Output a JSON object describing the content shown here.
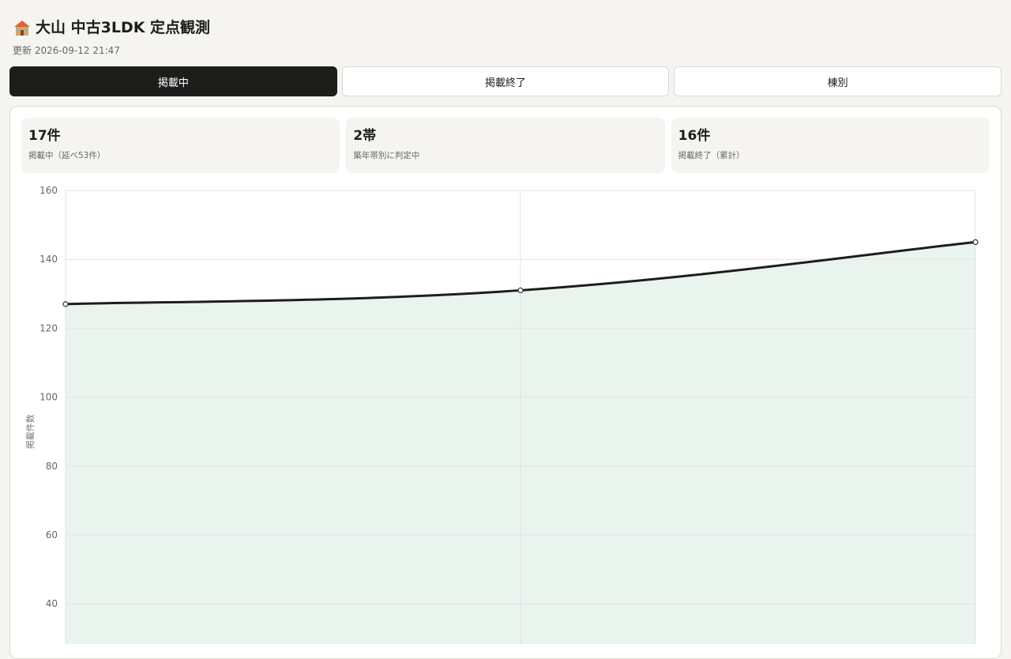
{
  "header": {
    "icon": "house-icon",
    "title": "大山 中古3LDK 定点観測",
    "updated": "更新 2026-09-12 21:47"
  },
  "tabs": [
    {
      "label": "掲載中",
      "active": true
    },
    {
      "label": "掲載終了",
      "active": false
    },
    {
      "label": "棟別",
      "active": false
    }
  ],
  "stats": [
    {
      "value": "17件",
      "label": "掲載中（延べ53件）"
    },
    {
      "value": "2帯",
      "label": "築年帯別に判定中"
    },
    {
      "value": "16件",
      "label": "掲載終了（累計）"
    }
  ],
  "colors": {
    "line": "#1d1d1b",
    "area": "#eaf4ee",
    "active_tab": "#1d1d1b"
  },
  "chart_data": {
    "type": "area",
    "x": [
      0,
      1,
      2
    ],
    "values": [
      127,
      131,
      145
    ],
    "ylabel": "掲載件数",
    "yticks": [
      40,
      60,
      80,
      100,
      120,
      140,
      160
    ],
    "ylim": [
      40,
      160
    ],
    "grid": true
  }
}
